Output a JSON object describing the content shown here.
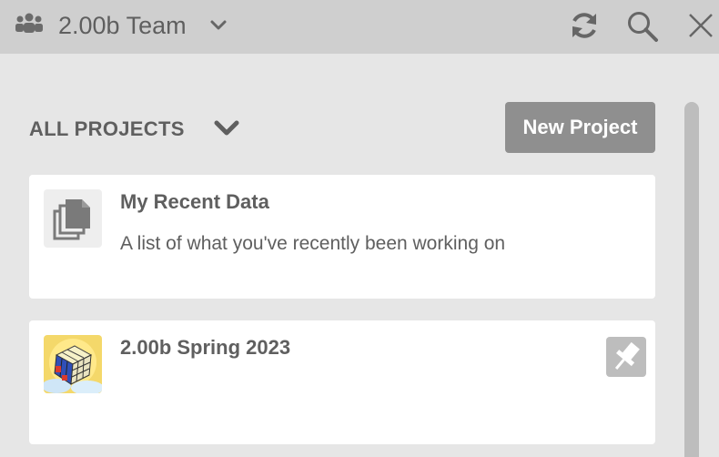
{
  "header": {
    "team_name": "2.00b Team",
    "icons": [
      "team-icon",
      "chevron-down-icon",
      "refresh-icon",
      "search-icon",
      "close-icon"
    ]
  },
  "projects": {
    "filter_label": "ALL PROJECTS",
    "new_button_label": "New Project",
    "items": [
      {
        "title": "My Recent Data",
        "description": "A list of what you've recently been working on",
        "thumb_icon": "documents-icon"
      },
      {
        "title": "2.00b Spring 2023",
        "description": "",
        "thumb_icon": "rubiks-cube-image",
        "pin_icon": "pin-icon"
      }
    ]
  },
  "colors": {
    "topbar_bg": "#cfcfcf",
    "page_bg": "#e6e6e6",
    "button_bg": "#8f8f8f",
    "text": "#5f5f5f"
  }
}
